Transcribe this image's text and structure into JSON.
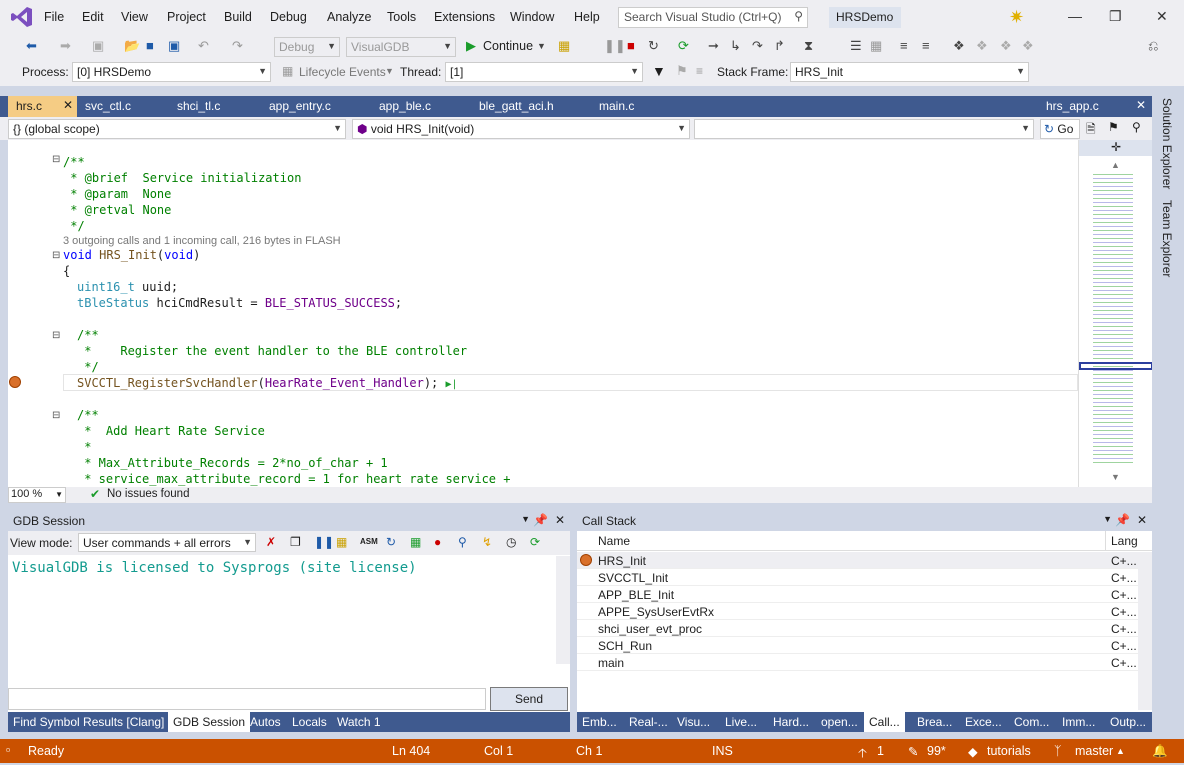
{
  "menu": [
    "File",
    "Edit",
    "View",
    "Project",
    "Build",
    "Debug",
    "Analyze",
    "Tools",
    "Extensions",
    "Window",
    "Help"
  ],
  "search": {
    "placeholder": "Search Visual Studio (Ctrl+Q)"
  },
  "solution_name": "HRSDemo",
  "toolbar": {
    "config": "Debug",
    "platform": "VisualGDB",
    "continue_label": "Continue"
  },
  "toolbar2": {
    "process_label": "Process:",
    "process_value": "[0] HRSDemo",
    "lifecycle_label": "Lifecycle Events",
    "thread_label": "Thread:",
    "thread_value": "[1]",
    "stack_frame_label": "Stack Frame:",
    "stack_frame_value": "HRS_Init"
  },
  "tabs": [
    "hrs.c",
    "svc_ctl.c",
    "shci_tl.c",
    "app_entry.c",
    "app_ble.c",
    "ble_gatt_aci.h",
    "main.c"
  ],
  "right_tab": "hrs_app.c",
  "navbar": {
    "scope": "{} (global scope)",
    "function": "void HRS_Init(void)",
    "go_label": "Go"
  },
  "code": {
    "l1": "/**",
    "l2": " * @brief  Service initialization",
    "l3": " * @param  None",
    "l4": " * @retval None",
    "l5": " */",
    "hint": "3 outgoing calls and 1 incoming call, 216 bytes in FLASH",
    "l6a": "void ",
    "l6b": "HRS_Init",
    "l6c": "(",
    "l6d": "void",
    "l6e": ")",
    "l7": "{",
    "l8a": "uint16_t",
    "l8b": " uuid;",
    "l9a": "tBleStatus",
    "l9b": " hciCmdResult = ",
    "l9c": "BLE_STATUS_SUCCESS",
    "l9d": ";",
    "l10": "/**",
    "l11": " *    Register the event handler to the BLE controller",
    "l12": " */",
    "l13a": "SVCCTL_RegisterSvcHandler",
    "l13b": "(",
    "l13c": "HearRate_Event_Handler",
    "l13d": ");",
    "l14": "/**",
    "l15": " *  Add Heart Rate Service",
    "l16": " *",
    "l17": " * Max_Attribute_Records = 2*no_of_char + 1",
    "l18": " * service_max_attribute_record = 1 for heart rate service +"
  },
  "editor_status": {
    "zoom": "100 %",
    "issues": "No issues found"
  },
  "gdb": {
    "title": "GDB Session",
    "view_mode_label": "View mode:",
    "view_mode_value": "User commands + all errors",
    "message": "VisualGDB is licensed to Sysprogs (site license)",
    "send_label": "Send"
  },
  "callstack": {
    "title": "Call Stack",
    "col_name": "Name",
    "col_lang": "Lang",
    "rows": [
      {
        "name": "HRS_Init",
        "lang": "C+..."
      },
      {
        "name": "SVCCTL_Init",
        "lang": "C+..."
      },
      {
        "name": "APP_BLE_Init",
        "lang": "C+..."
      },
      {
        "name": "APPE_SysUserEvtRx",
        "lang": "C+..."
      },
      {
        "name": "shci_user_evt_proc",
        "lang": "C+..."
      },
      {
        "name": "SCH_Run",
        "lang": "C+..."
      },
      {
        "name": "main",
        "lang": "C+..."
      }
    ]
  },
  "left_bottom_tabs": [
    "Find Symbol Results [Clang]",
    "GDB Session",
    "Autos",
    "Locals",
    "Watch 1"
  ],
  "right_bottom_tabs": [
    "Emb...",
    "Real-...",
    "Visu...",
    "Live...",
    "Hard...",
    "open...",
    "Call...",
    "Brea...",
    "Exce...",
    "Com...",
    "Imm...",
    "Outp..."
  ],
  "side_tabs": [
    "Solution Explorer",
    "Team Explorer"
  ],
  "status": {
    "ready": "Ready",
    "ln": "Ln 404",
    "col": "Col 1",
    "ch": "Ch 1",
    "ins": "INS",
    "up": "1",
    "pending": "99*",
    "repo": "tutorials",
    "branch": "master"
  },
  "colors": {
    "accent": "#3f5a8f",
    "status": "#ca5100",
    "active_tab": "#f5cc84"
  }
}
